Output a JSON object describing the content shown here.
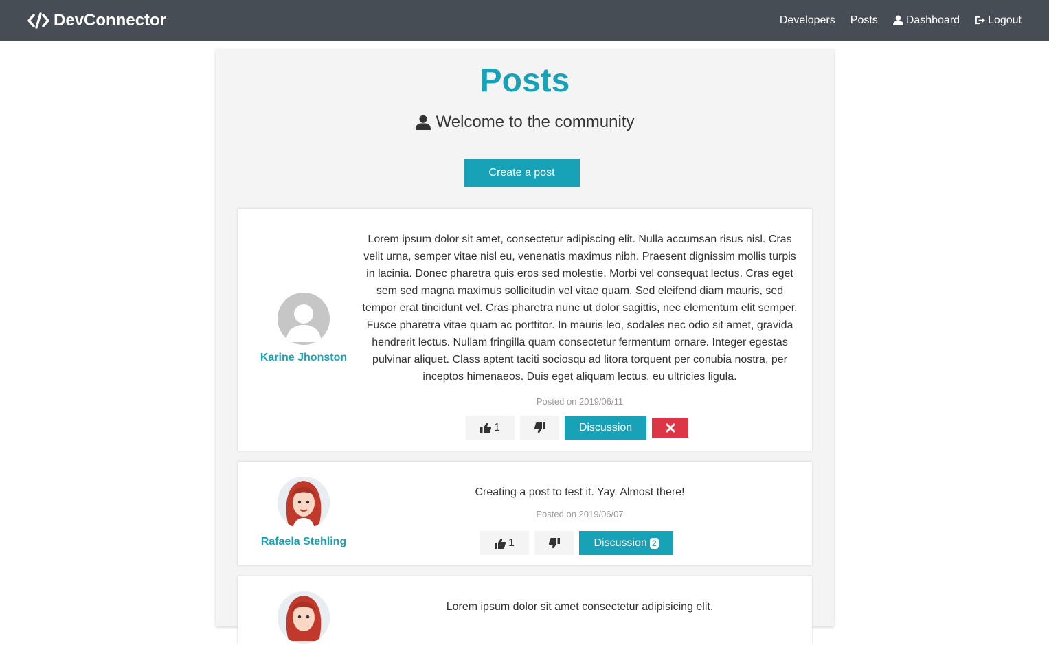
{
  "nav": {
    "brand": "DevConnector",
    "links": [
      {
        "label": "Developers",
        "icon": ""
      },
      {
        "label": "Posts",
        "icon": ""
      },
      {
        "label": "Dashboard",
        "icon": "user-icon"
      },
      {
        "label": "Logout",
        "icon": "sign-out-icon"
      }
    ]
  },
  "page": {
    "title": "Posts",
    "lead": "Welcome to the community",
    "create_button": "Create a post"
  },
  "posts": [
    {
      "author": "Karine Jhonston",
      "avatar": "default-avatar",
      "text": "Lorem ipsum dolor sit amet, consectetur adipiscing elit. Nulla accumsan risus nisl. Cras velit urna, semper vitae nisl eu, venenatis maximus nibh. Praesent dignissim mollis turpis in lacinia. Donec pharetra quis eros sed molestie. Morbi vel consequat lectus. Cras eget sem sed magna maximus sollicitudin vel vitae quam. Sed eleifend diam mauris, sed tempor erat tincidunt vel. Cras pharetra nunc ut dolor sagittis, nec elementum elit semper. Fusce pharetra vitae quam ac porttitor. In mauris leo, sodales nec odio sit amet, gravida hendrerit lectus. Nullam fringilla quam consectetur fermentum ornare. Integer egestas pulvinar aliquet. Class aptent taciti sociosqu ad litora torquent per conubia nostra, per inceptos himenaeos. Duis eget aliquam lectus, eu ultricies ligula.",
      "date": "Posted on 2019/06/11",
      "likes": "1",
      "discussion_label": "Discussion",
      "comments": ""
    },
    {
      "author": "Rafaela Stehling",
      "avatar": "red-hair-avatar",
      "text": "Creating a post to test it. Yay. Almost there!",
      "date": "Posted on 2019/06/07",
      "likes": "1",
      "discussion_label": "Discussion",
      "comments": "2"
    },
    {
      "author": "",
      "avatar": "red-hair-avatar",
      "text": "Lorem ipsum dolor sit amet consectetur adipisicing elit."
    }
  ],
  "colors": {
    "primary": "#17a2b8",
    "navbar": "#474d55",
    "danger": "#dc3545",
    "light": "#f4f4f4"
  }
}
